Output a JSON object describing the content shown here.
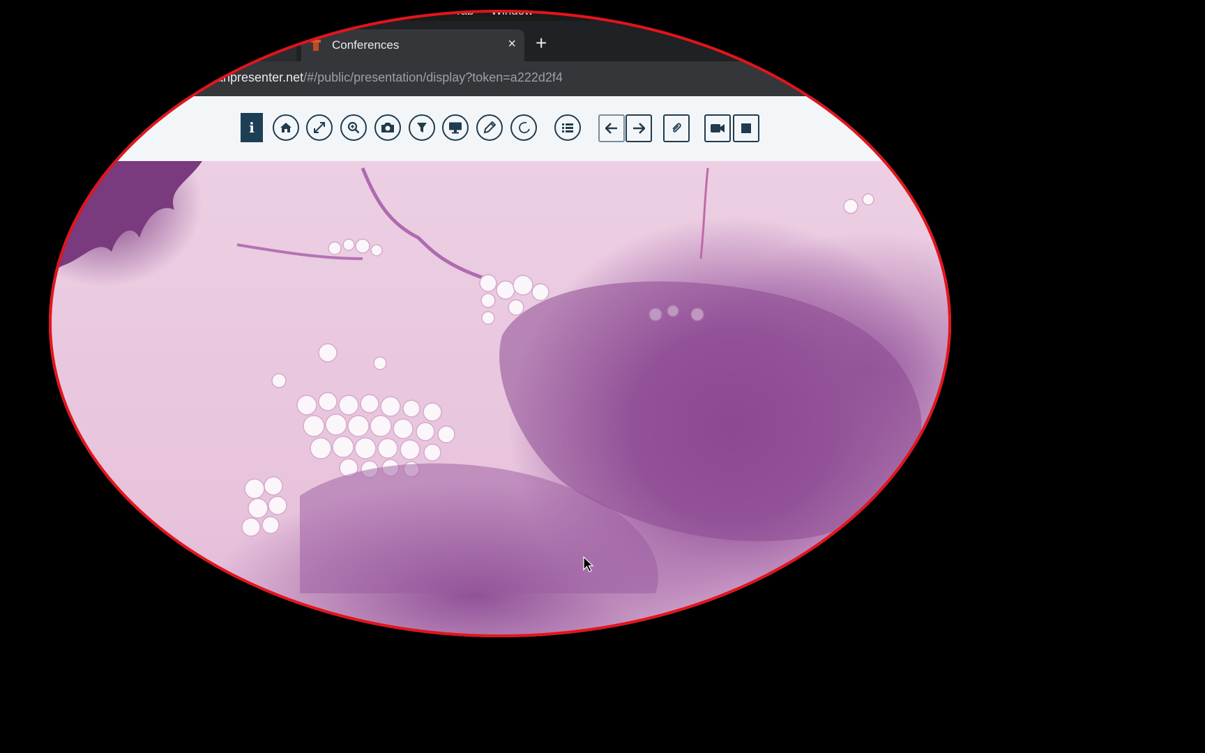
{
  "menu_bar": {
    "items": [
      "Tab",
      "Window"
    ]
  },
  "browser": {
    "active_tab": {
      "title": "Conferences",
      "close_glyph": "×"
    },
    "new_tab_glyph": "+",
    "url": {
      "host": ".pathpresenter.net",
      "path": "/#/public/presentation/display?token=a222d2f4"
    }
  },
  "toolbar": {
    "info_label": "i",
    "buttons": [
      {
        "name": "home-icon"
      },
      {
        "name": "fullscreen-icon"
      },
      {
        "name": "zoom-icon"
      },
      {
        "name": "camera-icon"
      },
      {
        "name": "filter-icon"
      },
      {
        "name": "monitor-icon"
      },
      {
        "name": "pencil-icon"
      },
      {
        "name": "lasso-icon"
      },
      {
        "name": "list-icon"
      },
      {
        "name": "arrow-left-icon"
      },
      {
        "name": "arrow-right-icon"
      },
      {
        "name": "paperclip-icon"
      },
      {
        "name": "video-camera-icon"
      },
      {
        "name": "stop-icon"
      }
    ]
  },
  "colors": {
    "highlight_ellipse": "#e3141b",
    "toolbar_accent": "#1d3f55"
  }
}
